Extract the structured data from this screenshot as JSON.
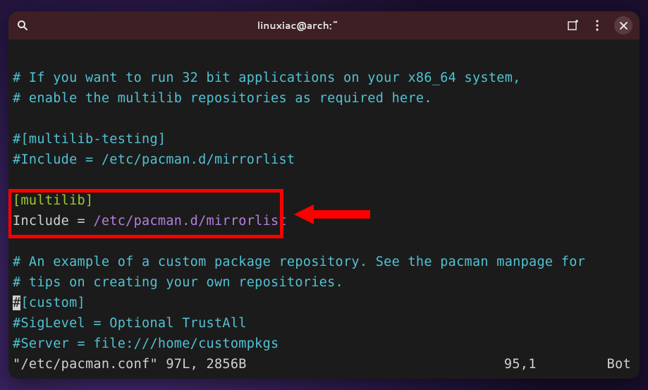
{
  "titlebar": {
    "title": "linuxiac@arch:~"
  },
  "lines": {
    "l1": "# If you want to run 32 bit applications on your x86_64 system,",
    "l2": "# enable the multilib repositories as required here.",
    "l3": "#[multilib-testing]",
    "l4": "#Include = /etc/pacman.d/mirrorlist",
    "l5_section": "[multilib]",
    "l6_key": "Include",
    "l6_eq": " = ",
    "l6_path": "/etc/pacman.d/mirrorlist",
    "l7": "# An example of a custom package repository.  See the pacman manpage for",
    "l8": "# tips on creating your own repositories.",
    "l9a": "#",
    "l9b": "[custom]",
    "l10": "#SigLevel = Optional TrustAll",
    "l11": "#Server = file:///home/custompkgs"
  },
  "status": {
    "file": "\"/etc/pacman.conf\" 97L, 2856B",
    "position": "95,1",
    "location": "Bot"
  }
}
